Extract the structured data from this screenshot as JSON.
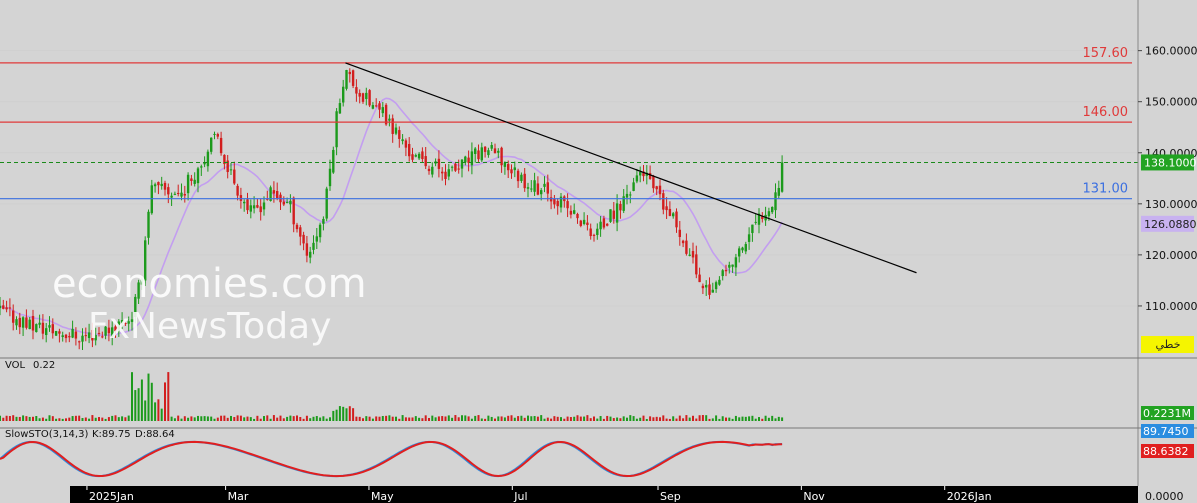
{
  "chart_data": [
    {
      "type": "candlestick",
      "panel": "price",
      "ylim": [
        100,
        166
      ],
      "yticks": [
        "160.0000",
        "150.0000",
        "140.0000",
        "130.0000",
        "120.0000",
        "110.0000"
      ],
      "ytick_values": [
        160,
        150,
        140,
        130,
        120,
        110
      ],
      "x_months": [
        "2025Jan",
        "Mar",
        "May",
        "Jul",
        "Sep",
        "Nov",
        "2026Jan"
      ],
      "candles": [],
      "moving_average": {
        "color": "#c39ef0"
      },
      "horizontal_levels": [
        {
          "value": 157.6,
          "label": "157.60",
          "color": "#e03a3a"
        },
        {
          "value": 146.0,
          "label": "146.00",
          "color": "#e03a3a"
        },
        {
          "value": 131.0,
          "label": "131.00",
          "color": "#3b6fe0"
        }
      ],
      "last_price_line": {
        "value": 138.1,
        "color": "#1a8a1a"
      },
      "trendline": {
        "from": {
          "date": "2025-04-21",
          "value": 157.6
        },
        "to": {
          "date": "2025-12-20",
          "value": 116.5
        },
        "color": "#000000"
      },
      "badges": [
        {
          "value": 138.1,
          "text": "138.1000",
          "bg": "#22a322",
          "fg": "#ffffff"
        },
        {
          "value": 126.088,
          "text": "126.0880",
          "bg": "#c8b2f0",
          "fg": "#222222"
        }
      ],
      "mode_badge": {
        "text": "خطي",
        "bg": "#f5f500",
        "fg": "#222222"
      }
    },
    {
      "type": "bar",
      "panel": "volume",
      "title": "VOL",
      "value_label": "0.22",
      "badge": {
        "text": "0.2231M",
        "bg": "#22a322",
        "fg": "#ffffff"
      },
      "volumes": []
    },
    {
      "type": "line",
      "panel": "stochastic",
      "title": "SlowSTO(3,14,3)",
      "k_label": "K:89.75",
      "d_label": "D:88.64",
      "series": [
        {
          "name": "K",
          "color": "#2a8de0",
          "values": []
        },
        {
          "name": "D",
          "color": "#e01f1f",
          "values": []
        }
      ],
      "badges": [
        {
          "text": "89.7450",
          "bg": "#2a8de0",
          "fg": "#ffffff"
        },
        {
          "text": "88.6382",
          "bg": "#e01f1f",
          "fg": "#ffffff"
        }
      ]
    }
  ],
  "watermark": {
    "line1": "economies.com",
    "line2": "FxNewsToday"
  },
  "bottom_axis": {
    "zero_label": "0.0000"
  }
}
